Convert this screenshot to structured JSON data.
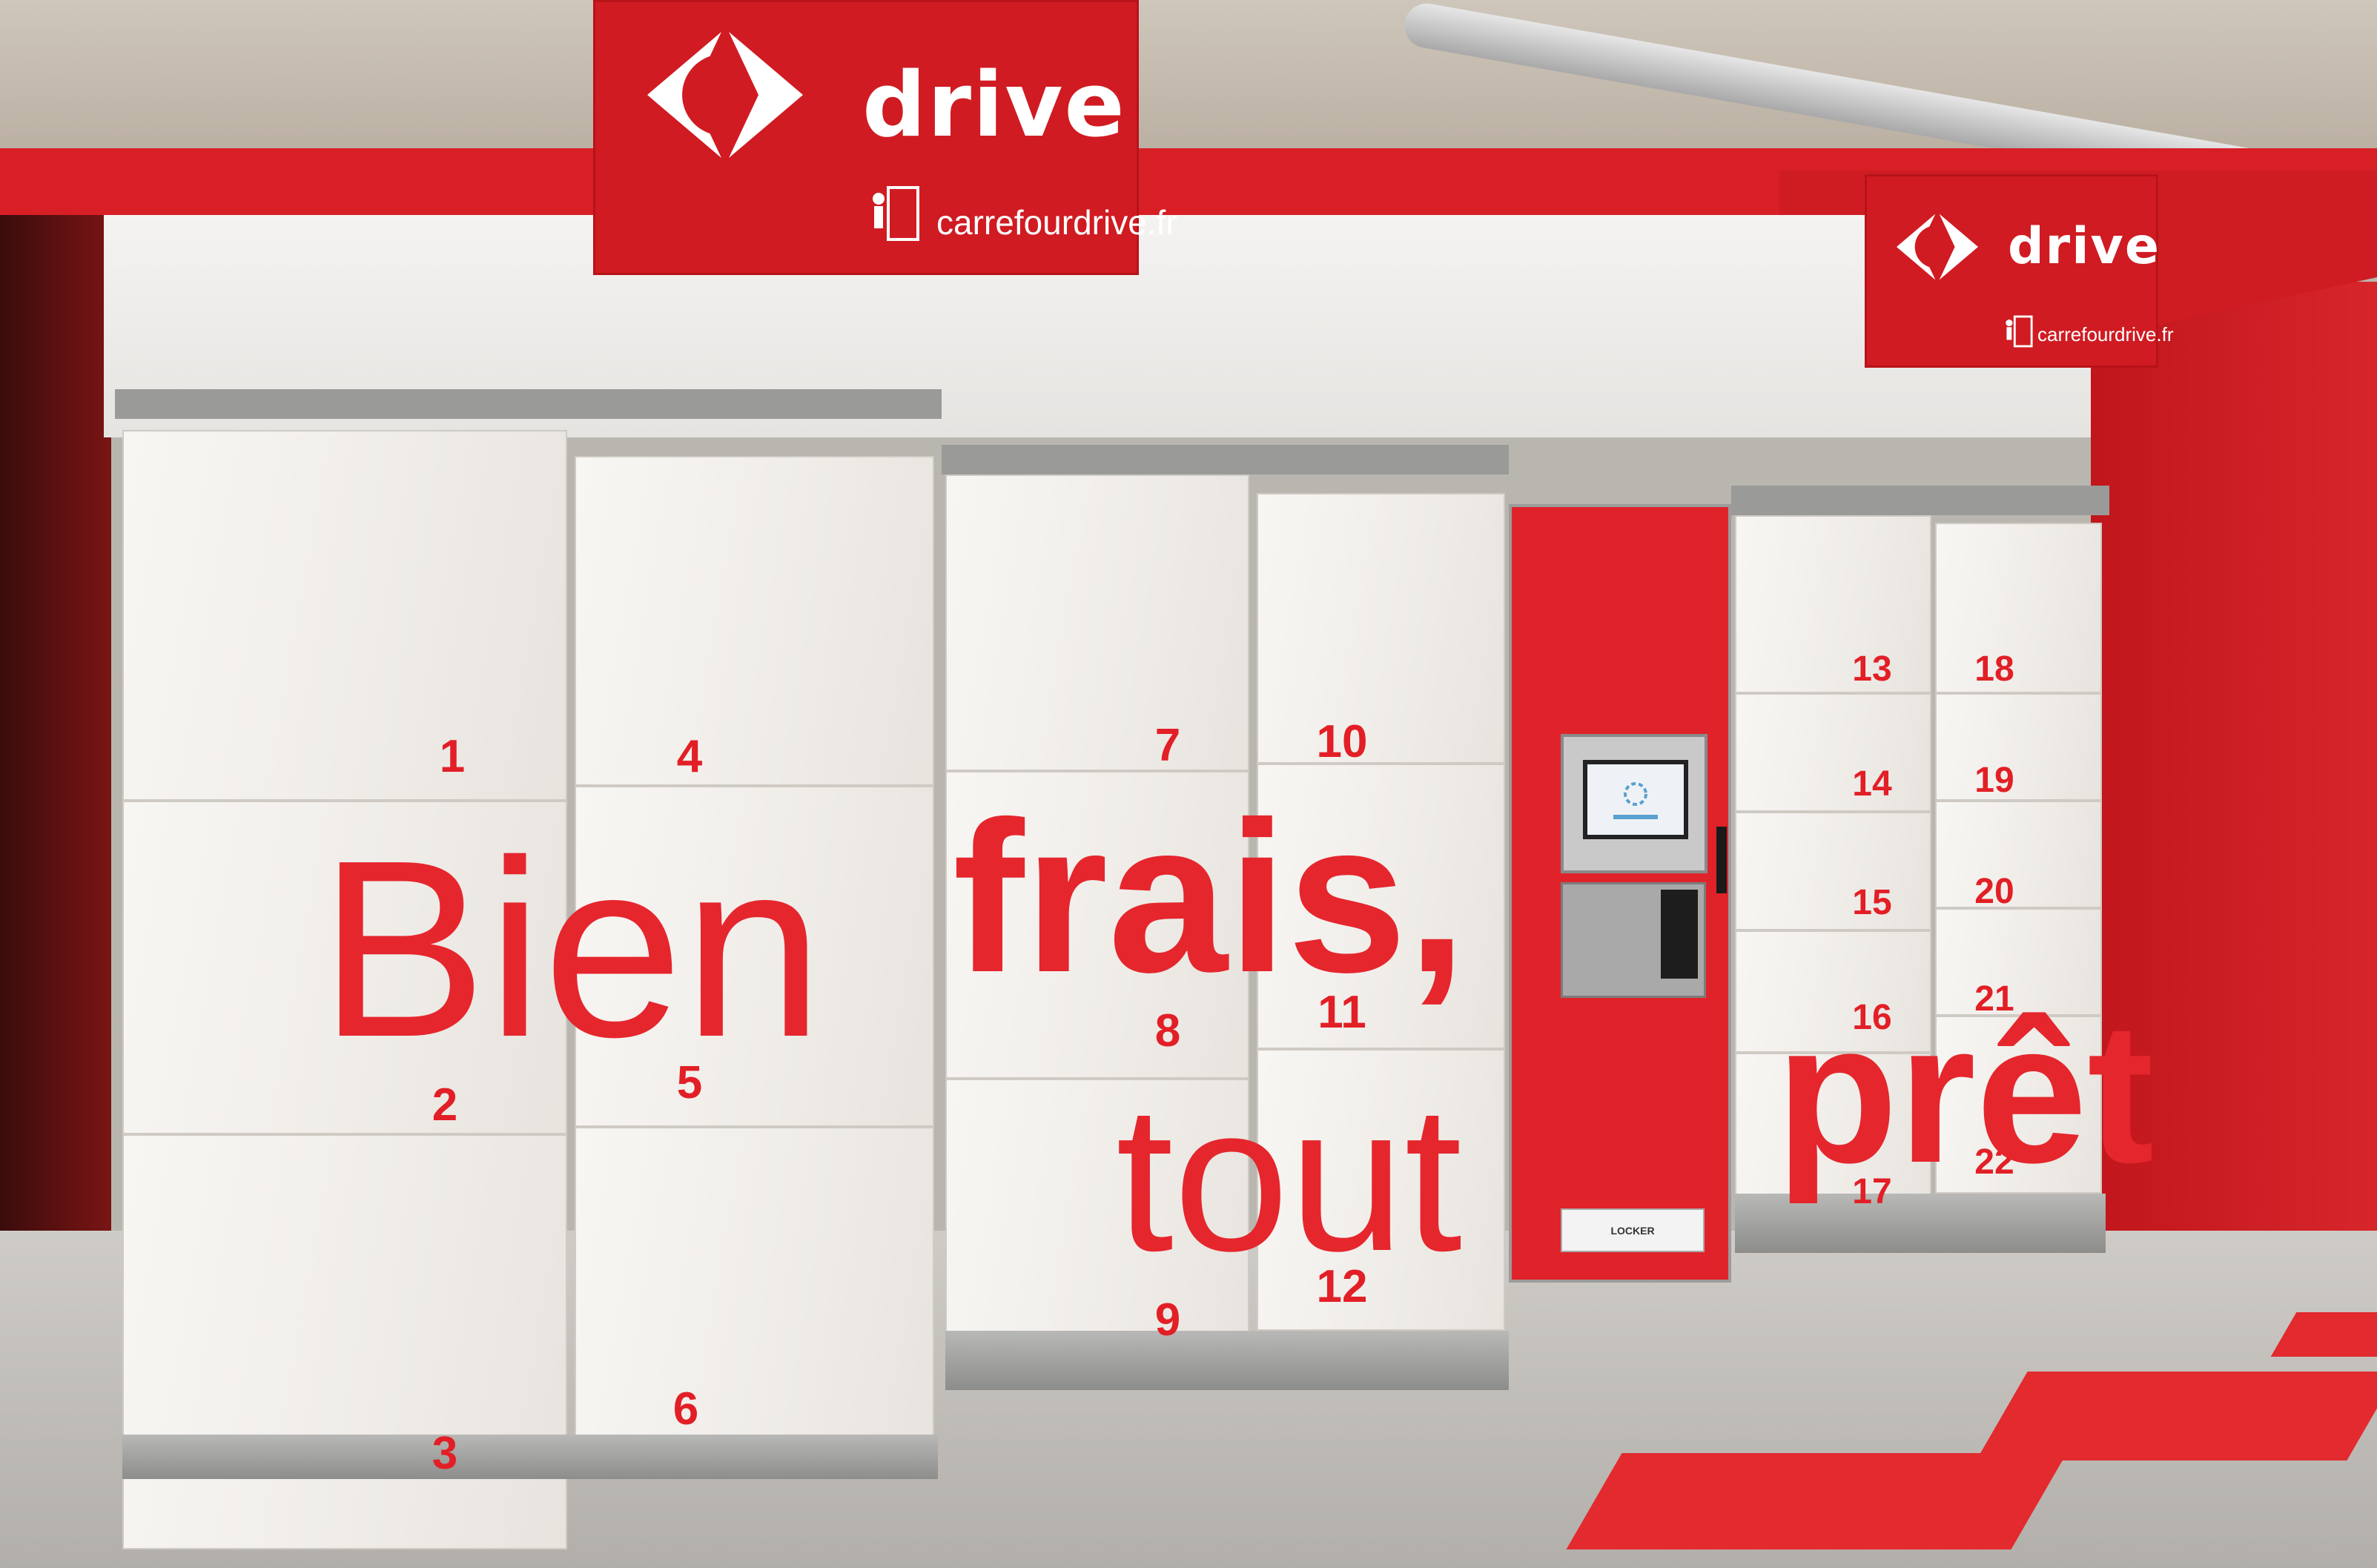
{
  "sign_left": {
    "brand": "drive",
    "website": "carrefourdrive.fr",
    "logo_icon": "carrefour-logo-icon"
  },
  "sign_right": {
    "brand": "drive",
    "website": "carrefourdrive.fr",
    "logo_icon": "carrefour-logo-icon"
  },
  "locker_numbers": [
    "1",
    "2",
    "3",
    "4",
    "5",
    "6",
    "7",
    "8",
    "9",
    "10",
    "11",
    "12",
    "13",
    "14",
    "15",
    "16",
    "17",
    "18",
    "19",
    "20",
    "21",
    "22"
  ],
  "slogan": {
    "word1": "Bien",
    "word2": "frais,",
    "word3": "tout",
    "word4": "prêt"
  },
  "kiosk": {
    "plaque": "LOCKER"
  },
  "colors": {
    "brand_red": "#d81f26",
    "door_white": "#f4f2ef",
    "number_red": "#e21f26"
  }
}
